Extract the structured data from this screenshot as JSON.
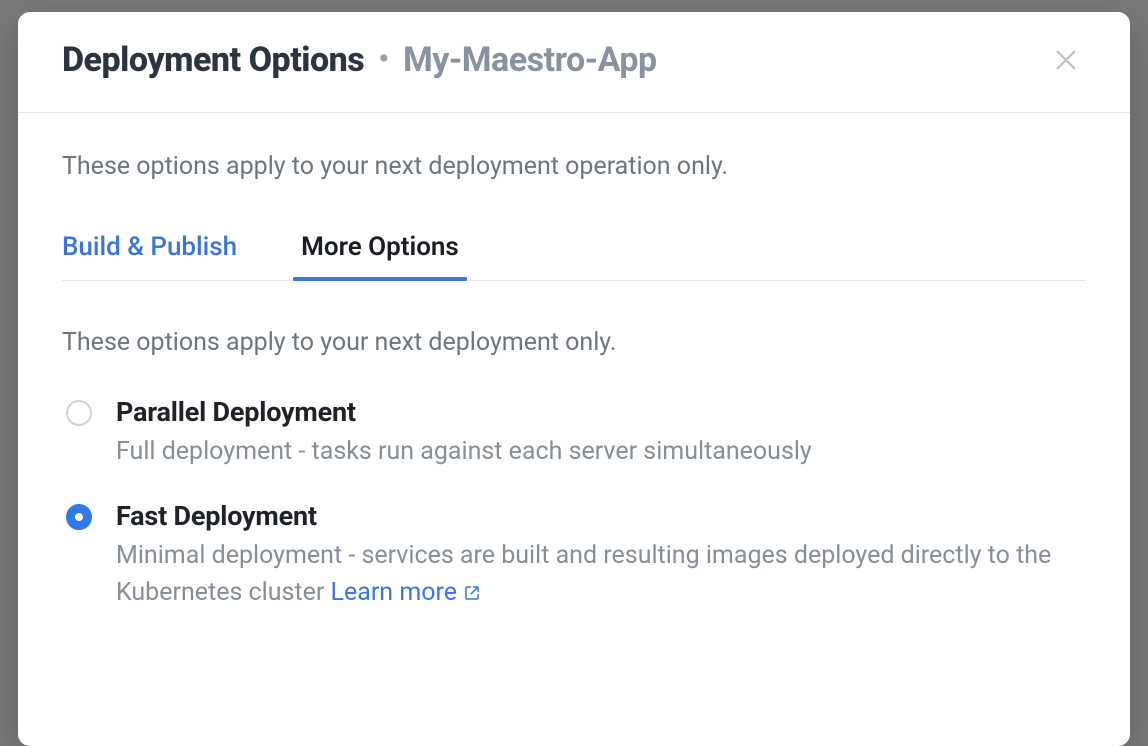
{
  "header": {
    "title": "Deployment Options",
    "app_name": "My-Maestro-App"
  },
  "intro": "These options apply to your next deployment operation only.",
  "tabs": {
    "build_publish": "Build & Publish",
    "more_options": "More Options"
  },
  "section": {
    "intro": "These options apply to your next deployment only.",
    "options": [
      {
        "title": "Parallel Deployment",
        "description": "Full deployment - tasks run against each server simultaneously",
        "selected": false
      },
      {
        "title": "Fast Deployment",
        "description": "Minimal deployment - services are built and resulting images deployed directly to the Kubernetes cluster ",
        "learn_more": "Learn more",
        "selected": true
      }
    ]
  }
}
